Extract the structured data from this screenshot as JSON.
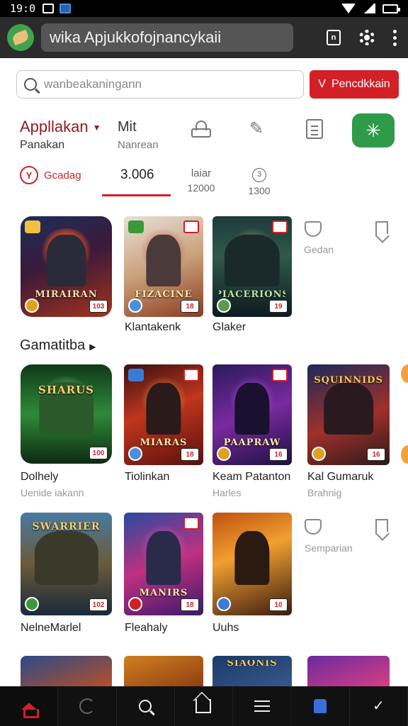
{
  "statusbar": {
    "time": "19:0"
  },
  "browser": {
    "url": "wika Apjukkofojnancykaii"
  },
  "search": {
    "placeholder": "wanbeakaningann",
    "button_label": "Pencdkkain",
    "button_icon": "chevron-down-icon"
  },
  "category": {
    "title": "Appllakan",
    "subtitle": "Panakan",
    "alt_title": "Mit",
    "alt_subtitle": "Nanrean",
    "action_icon": "star-icon",
    "accent": "#2e9a4a"
  },
  "stats": {
    "trend_label": "Gcadag",
    "count": "3.006",
    "col_a_label": "laiar",
    "col_a_value": "12000",
    "col_b_icon": "3",
    "col_b_value": "1300"
  },
  "row1": {
    "cards": [
      {
        "logo": "MIRAIRAN",
        "rating": "103"
      },
      {
        "logo": "FIZACINE",
        "rating": "18"
      },
      {
        "logo": "PIACERIONS",
        "rating": "19"
      }
    ],
    "titles": [
      "",
      "Klantakenk",
      "Glaker"
    ],
    "side_label": "Gedan"
  },
  "section": {
    "title": "Gamatitba"
  },
  "row2": {
    "cards": [
      {
        "logo": "SHARUS",
        "rating": "100"
      },
      {
        "logo": "MIARAS",
        "rating": "18"
      },
      {
        "logo": "PAAPRAW",
        "rating": "16"
      },
      {
        "logo": "SQUINNIDS",
        "rating": "16"
      }
    ],
    "titles": [
      "Dolhely",
      "Tiolinkan",
      "Keam Patanton",
      "Kal Gumaruk"
    ],
    "subtitles": [
      "Uenide iakann",
      "",
      "Harles",
      "Brahnig"
    ]
  },
  "row3": {
    "cards": [
      {
        "logo": "SWARRIER",
        "rating": "102"
      },
      {
        "logo": "MANIRS",
        "rating": "18"
      },
      {
        "logo": "",
        "rating": "10"
      }
    ],
    "titles": [
      "NelneMarlel",
      "Fleahaly",
      "Uuhs"
    ],
    "side_label": "Semparian"
  },
  "row4": {
    "cards": [
      {
        "logo": ""
      },
      {
        "logo": ""
      },
      {
        "logo": "SIAONIS"
      },
      {
        "logo": ""
      }
    ]
  },
  "colors": {
    "brand_red": "#d31f26",
    "accent_green": "#2e9a4a",
    "nav_bg": "#111111"
  }
}
